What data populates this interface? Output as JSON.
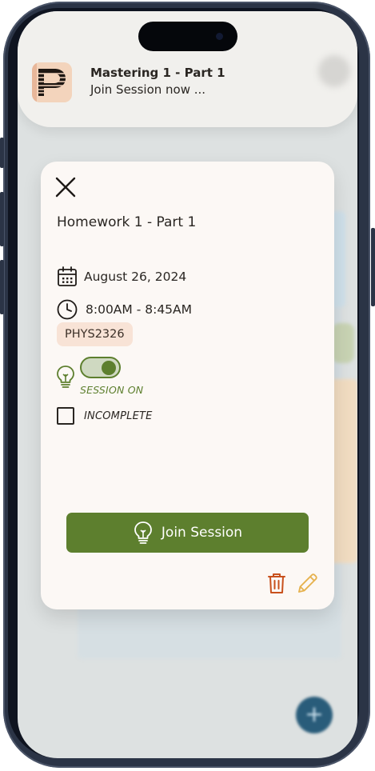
{
  "notification": {
    "app_icon": "app-logo-icon",
    "title": "Mastering 1 - Part 1",
    "body": "Join Session now ..."
  },
  "modal": {
    "title": "Homework 1 - Part 1",
    "date": "August 26, 2024",
    "time": "8:00AM - 8:45AM",
    "course_tag": "PHYS2326",
    "session_toggle_on": true,
    "session_status": "SESSION ON",
    "completion_status": "INCOMPLETE",
    "completed": false,
    "join_button_label": "Join Session"
  },
  "colors": {
    "accent_green": "#5d7f2e",
    "tag_background": "#f8e3d6",
    "delete_red": "#c8501c",
    "edit_yellow": "#e6b24f",
    "card_background": "#fcf8f5"
  },
  "background": {
    "time_labels": [
      "",
      "",
      "",
      "",
      "",
      "",
      "",
      "",
      "",
      "",
      "",
      ""
    ],
    "fab_label": "+"
  }
}
